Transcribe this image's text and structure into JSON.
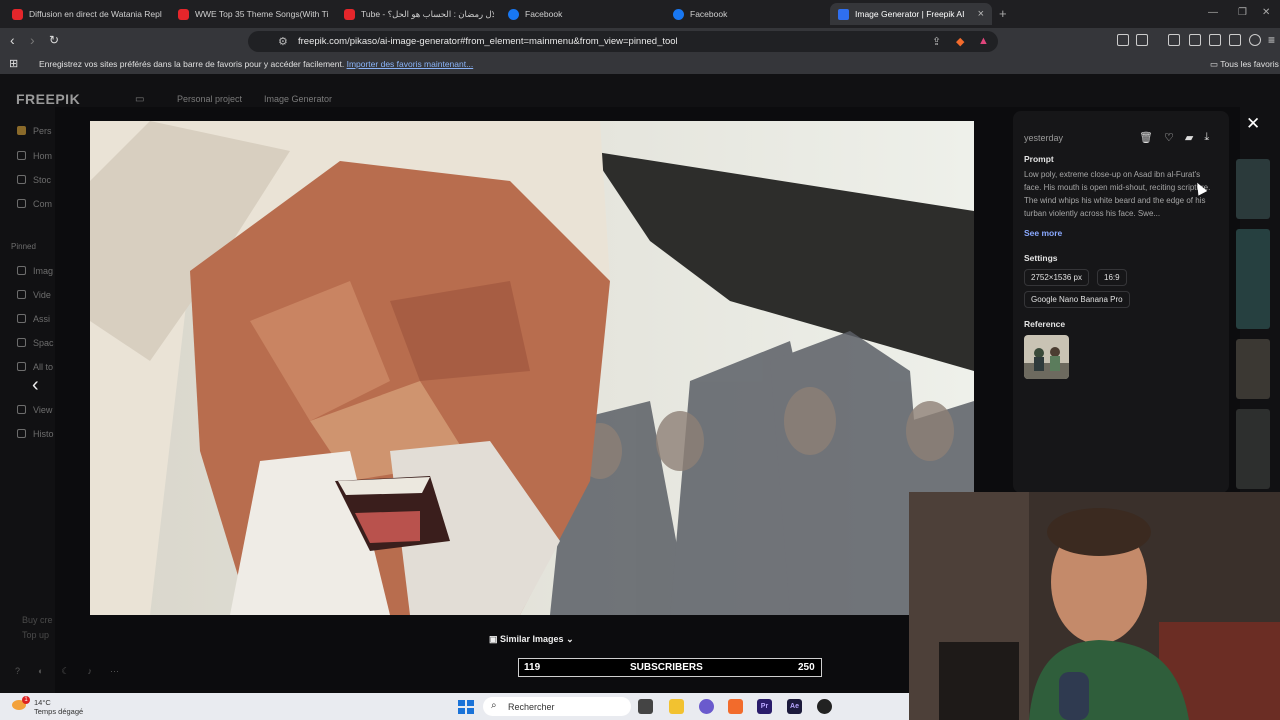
{
  "browser": {
    "tabs": [
      {
        "label": "Diffusion en direct de Watania Repla",
        "icon": "youtube-icon",
        "active": false
      },
      {
        "label": "WWE Top 35 Theme Songs(With Tit",
        "icon": "youtube-icon",
        "active": false
      },
      {
        "label": "Tube - هلال رمضان : الحساب هو الحل؟",
        "icon": "youtube-icon",
        "active": false
      },
      {
        "label": "Facebook",
        "icon": "facebook-icon",
        "active": false
      },
      {
        "label": "Facebook",
        "icon": "facebook-icon",
        "active": false
      },
      {
        "label": "Image Generator | Freepik AI",
        "icon": "freepik-icon",
        "active": true
      }
    ],
    "url": "freepik.com/pikaso/ai-image-generator#from_element=mainmenu&from_view=pinned_tool",
    "bookmarks_message": "Enregistrez vos sites préférés dans la barre de favoris pour y accéder facilement.",
    "bookmarks_link": "Importer des favoris maintenant...",
    "bookmarks_folder": "Tous les favoris"
  },
  "app": {
    "logo": "FREEPIK",
    "breadcrumb": [
      "Personal project",
      "Image Generator"
    ],
    "sidebar": [
      {
        "label": "Pers"
      },
      {
        "label": "Hom"
      },
      {
        "label": "Stoc"
      },
      {
        "label": "Com"
      },
      {
        "label": "Pinned"
      },
      {
        "label": "Imag"
      },
      {
        "label": "Vide"
      },
      {
        "label": "Assi"
      },
      {
        "label": "Spac"
      },
      {
        "label": "All to"
      },
      {
        "label": "View"
      },
      {
        "label": "Histo"
      }
    ],
    "sidebar_bottom": [
      "Buy cre",
      "Top up"
    ]
  },
  "panel": {
    "date": "yesterday",
    "prompt_heading": "Prompt",
    "prompt_text": "Low poly, extreme close-up on Asad ibn al-Furat's face. His mouth is open mid-shout, reciting scripture. The wind whips his white beard and the edge of his turban violently across his face. Swe...",
    "see_more": "See more",
    "settings_heading": "Settings",
    "resolution": "2752×1536 px",
    "aspect": "16:9",
    "model": "Google Nano Banana Pro",
    "reference_heading": "Reference"
  },
  "bottom": {
    "similar_images": "Similar Images",
    "subscribers_left": "119",
    "subscribers_label": "SUBSCRIBERS",
    "subscribers_right": "250"
  },
  "taskbar": {
    "temperature": "14°C",
    "weather": "Temps dégagé",
    "search_label": "Rechercher",
    "notification_count": "1",
    "apps": [
      "Pr",
      "Ae"
    ]
  },
  "colors": {
    "accent_link": "#8aa9ff",
    "background": "#111113",
    "panel": "#161618"
  }
}
